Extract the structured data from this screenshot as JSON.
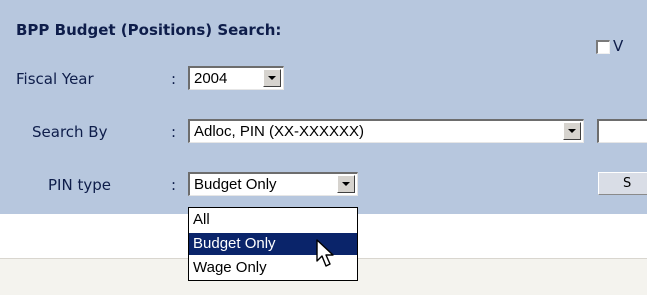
{
  "title": "BPP Budget (Positions) Search:",
  "fields": {
    "fiscal_year": {
      "label": "Fiscal Year",
      "colon": ":",
      "value": "2004"
    },
    "search_by": {
      "label": "Search By",
      "colon": ":",
      "value": "Adloc, PIN (XX-XXXXXX)"
    },
    "pin_type": {
      "label": "PIN type",
      "colon": ":",
      "value": "Budget Only",
      "options": [
        "All",
        "Budget Only",
        "Wage Only"
      ],
      "highlighted": "Budget Only"
    }
  },
  "checkbox": {
    "label": "V",
    "checked": false
  },
  "search_button": {
    "label": "S"
  },
  "colors": {
    "panel_bg": "#b7c7de",
    "label_text": "#0e1d4a",
    "selection": "#0a246a"
  },
  "icons": [
    "dropdown-arrow-icon",
    "mouse-pointer-icon"
  ]
}
